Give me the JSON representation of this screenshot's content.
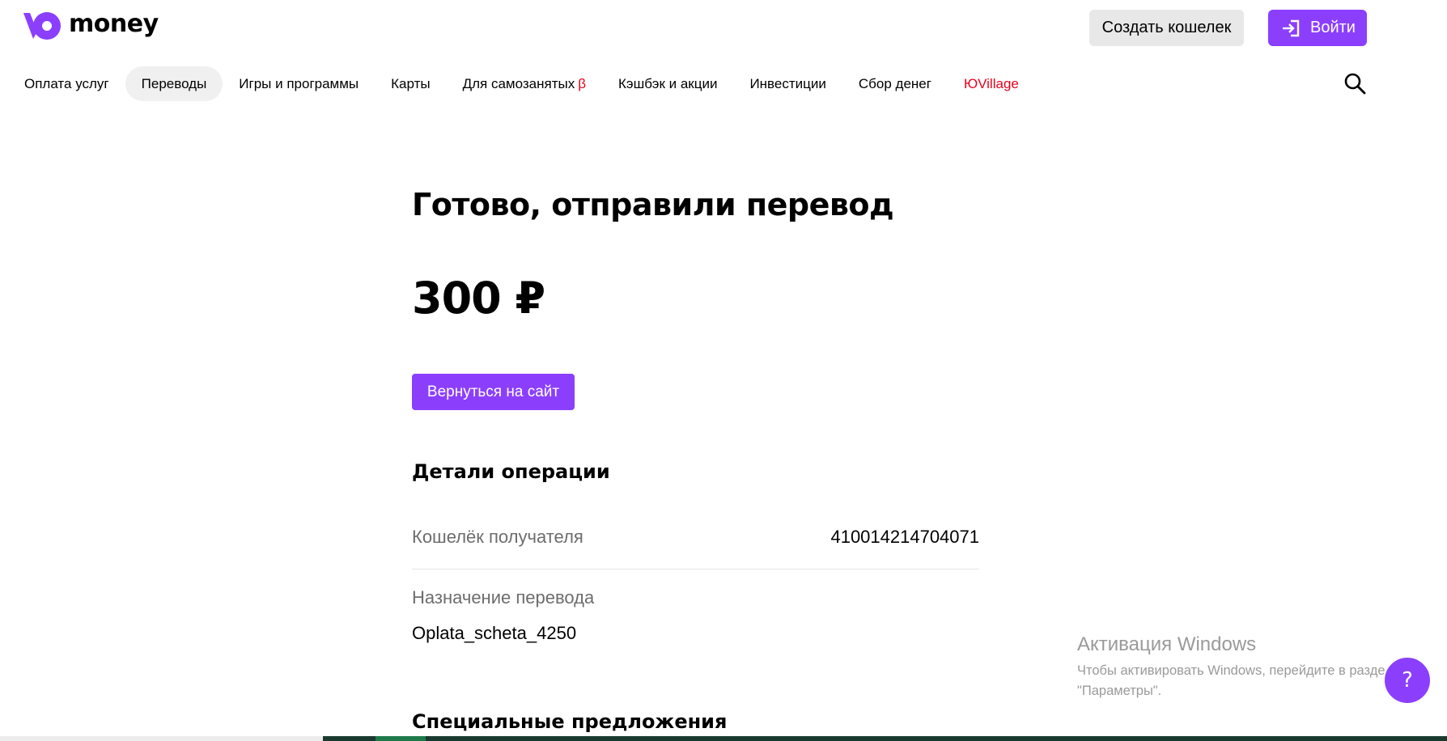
{
  "header": {
    "logo_text": "money",
    "create_wallet_label": "Создать кошелек",
    "login_label": "Войти"
  },
  "nav": {
    "items": [
      {
        "label": "Оплата услуг"
      },
      {
        "label": "Переводы",
        "active": true
      },
      {
        "label": "Игры и программы"
      },
      {
        "label": "Карты"
      },
      {
        "label": "Для самозанятых",
        "badge": "β"
      },
      {
        "label": "Кэшбэк и акции"
      },
      {
        "label": "Инвестиции"
      },
      {
        "label": "Сбор денег"
      },
      {
        "label": "ЮVillage",
        "color": "#e8001c"
      }
    ],
    "search_icon": "search-icon"
  },
  "main": {
    "title": "Готово, отправили перевод",
    "amount": "300 ₽",
    "back_button_label": "Вернуться на сайт",
    "details_title": "Детали операции",
    "details": {
      "recipient_wallet_label": "Кошелёк получателя",
      "recipient_wallet_value": "410014214704071",
      "purpose_label": "Назначение перевода",
      "purpose_value": "Oplata_scheta_4250"
    },
    "offers_title": "Специальные предложения"
  },
  "watermark": {
    "title": "Активация Windows",
    "text": "Чтобы активировать Windows, перейдите в раздел \"Параметры\"."
  },
  "help": {
    "label": "?"
  },
  "colors": {
    "accent": "#8b3ffd",
    "highlight_red": "#e8001c",
    "muted_text": "#6d6d6d"
  }
}
